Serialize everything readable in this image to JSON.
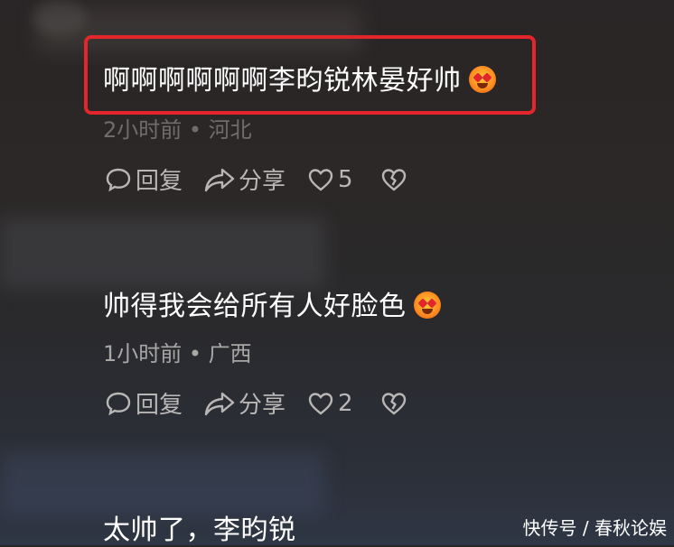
{
  "comments": [
    {
      "text": "啊啊啊啊啊啊李昀锐林晏好帅",
      "meta": "2小时前 • 河北",
      "reply_label": "回复",
      "share_label": "分享",
      "like_count": "5"
    },
    {
      "text": "帅得我会给所有人好脸色",
      "meta": "1小时前 • 广西",
      "reply_label": "回复",
      "share_label": "分享",
      "like_count": "2"
    },
    {
      "text": "太帅了，李昀锐"
    }
  ],
  "watermark": "快传号 / 春秋论娱",
  "colors": {
    "highlight_border": "#e2262c",
    "meta_text": "#a9a6a6",
    "action_text": "#b9b6b6"
  }
}
